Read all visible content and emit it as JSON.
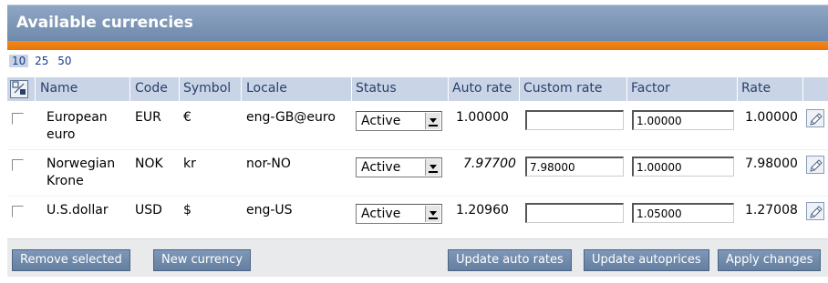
{
  "window": {
    "title": "Available currencies"
  },
  "page_size": {
    "options": [
      "10",
      "25",
      "50"
    ],
    "selected": "10"
  },
  "table": {
    "headers": {
      "name": "Name",
      "code": "Code",
      "symbol": "Symbol",
      "locale": "Locale",
      "status": "Status",
      "auto_rate": "Auto rate",
      "custom_rate": "Custom rate",
      "factor": "Factor",
      "rate": "Rate"
    },
    "rows": [
      {
        "name_line1": "European",
        "name_line2": "euro",
        "code": "EUR",
        "symbol": "€",
        "locale": "eng-GB@euro",
        "status": "Active",
        "auto_rate": "1.00000",
        "auto_rate_muted": false,
        "custom_rate": "",
        "factor": "1.00000",
        "rate": "1.00000"
      },
      {
        "name_line1": "Norwegian",
        "name_line2": "Krone",
        "code": "NOK",
        "symbol": "kr",
        "locale": "nor-NO",
        "status": "Active",
        "auto_rate": "7.97700",
        "auto_rate_muted": true,
        "custom_rate": "7.98000",
        "factor": "1.00000",
        "rate": "7.98000"
      },
      {
        "name_line1": "U.S.dollar",
        "name_line2": "",
        "code": "USD",
        "symbol": "$",
        "locale": "eng-US",
        "status": "Active",
        "auto_rate": "1.20960",
        "auto_rate_muted": false,
        "custom_rate": "",
        "factor": "1.05000",
        "rate": "1.27008"
      }
    ]
  },
  "footer": {
    "remove_selected": "Remove selected",
    "new_currency": "New currency",
    "update_auto_rates": "Update auto rates",
    "update_autoprices": "Update autoprices",
    "apply_changes": "Apply changes"
  },
  "colors": {
    "title_bar": "#7d95b6",
    "accent_bar": "#ee7f12",
    "header_row": "#c9d5e6",
    "button": "#6f88ab"
  },
  "icons": {
    "header_toggle": "toggle-selection-icon",
    "row_action": "edit-pencil-icon",
    "select_arrow": "chevron-down-icon"
  }
}
